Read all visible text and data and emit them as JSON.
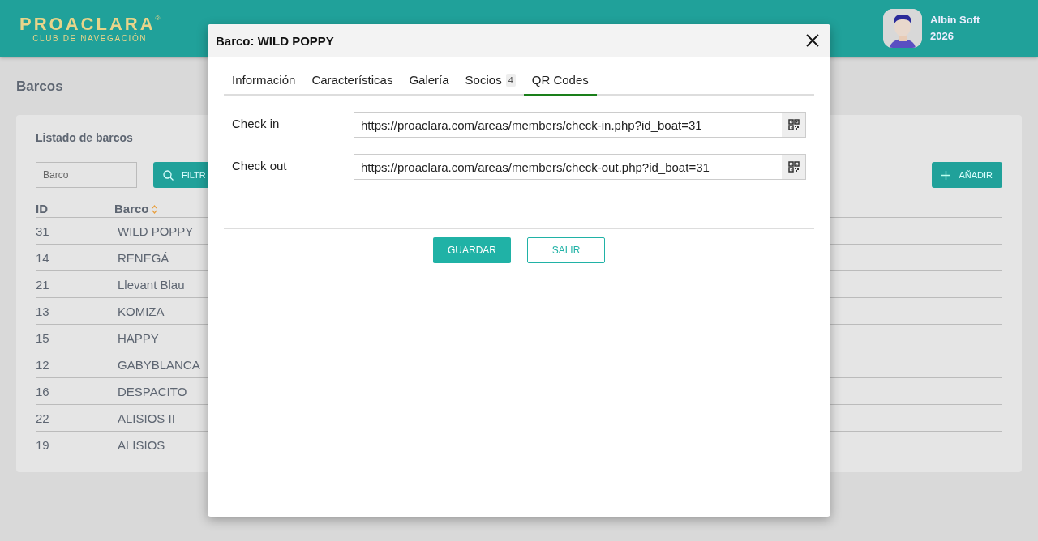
{
  "header": {
    "logo": "PROACLARA",
    "logo_mark": "®",
    "logo_subtitle": "CLUB DE NAVEGACIÓN",
    "user_name": "Albin Soft",
    "user_year": "2026"
  },
  "page_title": "Barcos",
  "card": {
    "title": "Listado de barcos",
    "search": {
      "placeholder": "Barco"
    },
    "filter_button": "FILTR",
    "add_button": "AÑADIR",
    "table": {
      "columns": [
        "ID",
        "Barco"
      ],
      "rows": [
        {
          "id": "31",
          "name": "WILD POPPY"
        },
        {
          "id": "14",
          "name": "RENEGÁ"
        },
        {
          "id": "21",
          "name": "Llevant Blau"
        },
        {
          "id": "13",
          "name": "KOMIZA"
        },
        {
          "id": "15",
          "name": "HAPPY"
        },
        {
          "id": "12",
          "name": "GABYBLANCA"
        },
        {
          "id": "16",
          "name": "DESPACITO"
        },
        {
          "id": "22",
          "name": "ALISIOS II"
        },
        {
          "id": "19",
          "name": "ALISIOS"
        }
      ]
    }
  },
  "dialog": {
    "title": "Barco: WILD POPPY",
    "tabs": [
      {
        "label": "Información",
        "selected": false
      },
      {
        "label": "Características",
        "selected": false
      },
      {
        "label": "Galería",
        "selected": false
      },
      {
        "label": "Socios",
        "badge": "4",
        "selected": false
      },
      {
        "label": "QR Codes",
        "selected": true
      }
    ],
    "fields": [
      {
        "label": "Check in",
        "value": "https://proaclara.com/areas/members/check-in.php?id_boat=31"
      },
      {
        "label": "Check out",
        "value": "https://proaclara.com/areas/members/check-out.php?id_boat=31"
      }
    ],
    "buttons": [
      {
        "label": "GUARDAR",
        "kind": "primary"
      },
      {
        "label": "SALIR",
        "kind": "outline"
      }
    ]
  }
}
